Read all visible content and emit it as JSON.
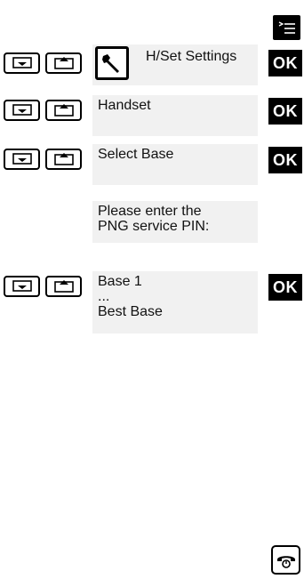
{
  "menu_key": {
    "icon": "menu-list-icon"
  },
  "steps": [
    {
      "nav_keys": [
        "down-arrow-icon",
        "up-arrow-icon"
      ],
      "tool_icon": "wrench-icon",
      "label": "H/Set Settings",
      "ok_label": "OK"
    },
    {
      "nav_keys": [
        "down-arrow-icon",
        "up-arrow-icon"
      ],
      "label": "Handset",
      "ok_label": "OK"
    },
    {
      "nav_keys": [
        "down-arrow-icon",
        "up-arrow-icon"
      ],
      "label": "Select Base",
      "ok_label": "OK"
    },
    {
      "lines": [
        "Please enter the",
        "PNG service PIN:"
      ]
    },
    {
      "nav_keys": [
        "down-arrow-icon",
        "up-arrow-icon"
      ],
      "lines": [
        "Base 1",
        "...",
        "Best Base"
      ],
      "ok_label": "OK"
    }
  ],
  "end_key": {
    "icon": "end-call-icon"
  }
}
